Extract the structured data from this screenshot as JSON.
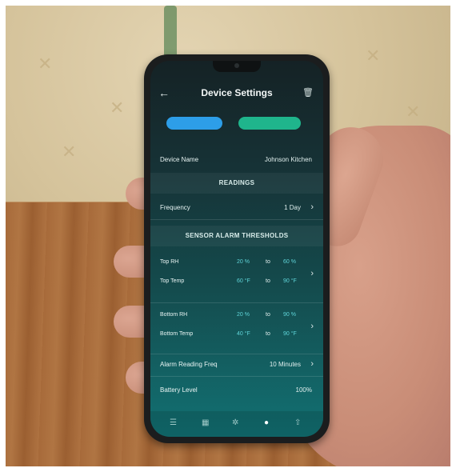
{
  "header": {
    "title": "Device Settings"
  },
  "buttons": {
    "blue": "",
    "green": ""
  },
  "device_name": {
    "label": "Device Name",
    "value": "Johnson Kitchen"
  },
  "sections": {
    "readings": "READINGS",
    "alarms": "SENSOR ALARM THRESHOLDS"
  },
  "frequency": {
    "label": "Frequency",
    "value": "1 Day"
  },
  "top": {
    "rh_label": "Top RH",
    "rh_min": "20 %",
    "rh_to": "to",
    "rh_max": "60 %",
    "temp_label": "Top Temp",
    "temp_min": "60 °F",
    "temp_to": "to",
    "temp_max": "90 °F"
  },
  "bottom": {
    "rh_label": "Bottom RH",
    "rh_min": "20 %",
    "rh_to": "to",
    "rh_max": "90 %",
    "temp_label": "Bottom Temp",
    "temp_min": "40 °F",
    "temp_to": "to",
    "temp_max": "90 °F"
  },
  "alarm_freq": {
    "label": "Alarm Reading Freq",
    "value": "10 Minutes"
  },
  "battery": {
    "label": "Battery Level",
    "value": "100%"
  },
  "nav_icons": [
    "list-icon",
    "calendar-icon",
    "gear-icon",
    "home-icon",
    "upload-icon"
  ]
}
